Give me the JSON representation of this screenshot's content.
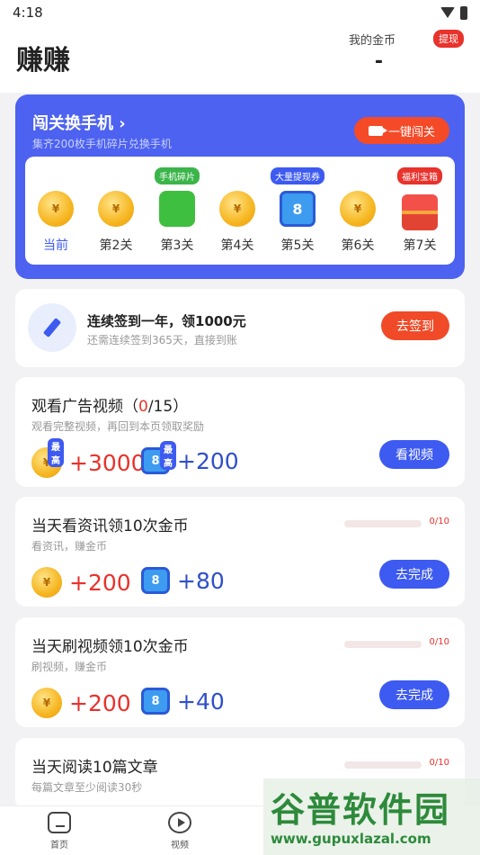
{
  "status": {
    "time": "4:18"
  },
  "header": {
    "title": "赚赚",
    "coin_label": "我的金币",
    "withdraw": "提现",
    "coin_value": "-"
  },
  "levels": {
    "title": "闯关换手机",
    "chevron": "›",
    "subtitle": "集齐200枚手机碎片兑换手机",
    "one_key": "一键闯关",
    "steps": [
      {
        "label": "当前",
        "icon": "coin-icon",
        "current": true
      },
      {
        "label": "第2关",
        "icon": "coin-icon"
      },
      {
        "label": "第3关",
        "icon": "puzzle-icon",
        "tag": "手机碎片",
        "tag_color": "#3bb54a"
      },
      {
        "label": "第4关",
        "icon": "coin-icon"
      },
      {
        "label": "第5关",
        "icon": "ticket-icon",
        "tag": "大量提现券",
        "tag_color": "#3d5af1"
      },
      {
        "label": "第6关",
        "icon": "coin-icon"
      },
      {
        "label": "第7关",
        "icon": "chest-icon",
        "tag": "福利宝箱",
        "tag_color": "#e8322c"
      }
    ]
  },
  "signin": {
    "title": "连续签到一年，领1000元",
    "subtitle": "还需连续签到365天，直接到账",
    "button": "去签到"
  },
  "ads": {
    "title_prefix": "观看广告视频（",
    "count": "0",
    "title_suffix": "/15）",
    "subtitle": "观看完整视频，再回到本页领取奖励",
    "badge": "最高",
    "coin_reward": "+3000",
    "ticket_reward": "+200",
    "button": "看视频"
  },
  "tasks": [
    {
      "title": "当天看资讯领10次金币",
      "subtitle": "看资讯，赚金币",
      "progress": "0/10",
      "progress_value": 0,
      "coin_reward": "+200",
      "ticket_reward": "+80",
      "button": "去完成"
    },
    {
      "title": "当天刷视频领10次金币",
      "subtitle": "刷视频，赚金币",
      "progress": "0/10",
      "progress_value": 0,
      "coin_reward": "+200",
      "ticket_reward": "+40",
      "button": "去完成"
    },
    {
      "title": "当天阅读10篇文章",
      "subtitle": "每篇文章至少阅读30秒",
      "progress": "0/10",
      "progress_value": 0
    }
  ],
  "tabbar": {
    "home": "首页",
    "video": "视频"
  },
  "coin_symbol": "¥",
  "ticket_symbol": "8",
  "watermark": {
    "main": "谷普软件园",
    "url": "www.gupuxlazal.com"
  }
}
